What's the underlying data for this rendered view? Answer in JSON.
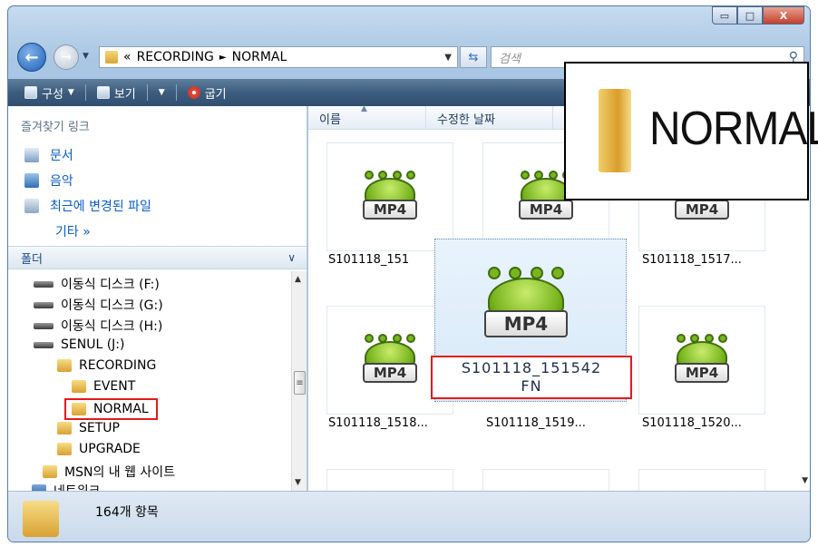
{
  "window": {
    "minimize": "▭",
    "maximize": "□",
    "close": "X"
  },
  "address": {
    "crumb_prefix": "«",
    "segments": [
      "RECORDING",
      "NORMAL"
    ],
    "separator": "►"
  },
  "search": {
    "placeholder": "검색"
  },
  "toolbar": {
    "organize": "구성",
    "views": "보기",
    "burn": "굽기"
  },
  "favorites": {
    "title": "즐겨찾기 링크",
    "items": [
      "문서",
      "음악",
      "최근에 변경된 파일"
    ],
    "more": "기타 »"
  },
  "folders": {
    "title": "폴더",
    "tree": [
      {
        "label": "이동식 디스크 (F:)",
        "type": "drive"
      },
      {
        "label": "이동식 디스크 (G:)",
        "type": "drive"
      },
      {
        "label": "이동식 디스크 (H:)",
        "type": "drive"
      },
      {
        "label": "SENUL (J:)",
        "type": "drive"
      },
      {
        "label": "RECORDING",
        "type": "folder"
      },
      {
        "label": "EVENT",
        "type": "folder"
      },
      {
        "label": "NORMAL",
        "type": "folder",
        "selected": true
      },
      {
        "label": "SETUP",
        "type": "folder"
      },
      {
        "label": "UPGRADE",
        "type": "folder"
      },
      {
        "label": "MSN의 내 웹 사이트",
        "type": "folder"
      },
      {
        "label": "네트워크",
        "type": "network"
      }
    ]
  },
  "columns": [
    "이름",
    "수정한 날짜"
  ],
  "files": [
    {
      "name": "S101118_151",
      "icon_label": "MP4"
    },
    {
      "name": "",
      "icon_label": "MP4"
    },
    {
      "name": "S101118_1517...",
      "icon_label": "MP4"
    },
    {
      "name": "S101118_1518...",
      "icon_label": "MP4"
    },
    {
      "name": "S101118_1519...",
      "icon_label": "MP4"
    },
    {
      "name": "S101118_1520...",
      "icon_label": "MP4"
    }
  ],
  "selected_file": {
    "name_line1": "S101118_151542",
    "name_line2": "FN",
    "icon_label": "MP4"
  },
  "zoom_inset": {
    "label": "NORMAL"
  },
  "status": {
    "item_count": "164개 항목"
  },
  "colors": {
    "selection_outline": "#e31b1b",
    "toolbar": "#3d5d7e",
    "link": "#0b5cc2"
  }
}
